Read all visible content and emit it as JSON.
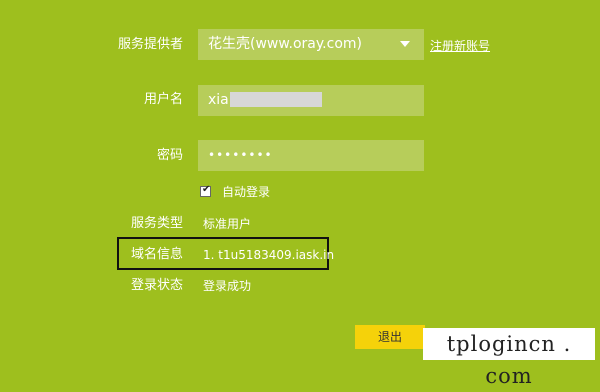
{
  "form": {
    "provider": {
      "label": "服务提供者",
      "value": "花生壳(www.oray.com)",
      "register_link": "注册新账号"
    },
    "username": {
      "label": "用户名",
      "value": "xia"
    },
    "password": {
      "label": "密码",
      "value": "••••••••"
    },
    "auto_login": {
      "label": "自动登录",
      "checked": true
    },
    "service_type": {
      "label": "服务类型",
      "value": "标准用户"
    },
    "domain_info": {
      "label": "域名信息",
      "value": "1. t1u5183409.iask.in"
    },
    "login_status": {
      "label": "登录状态",
      "value": "登录成功"
    },
    "logout_button": "退出"
  },
  "watermark": "tplogincn . com",
  "colors": {
    "background": "#9ebf1e",
    "field": "#b7cd5a",
    "button": "#f5d20a",
    "highlight_border": "#111111"
  }
}
